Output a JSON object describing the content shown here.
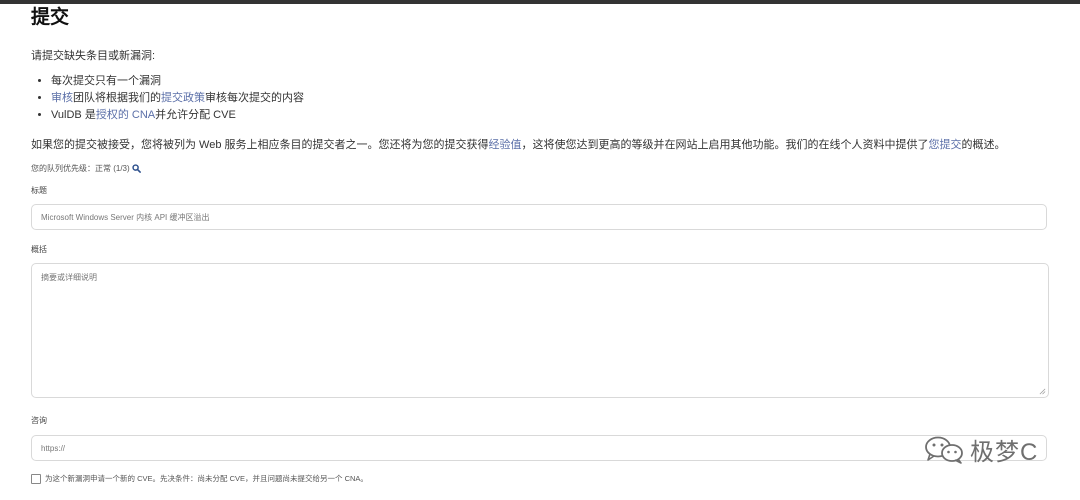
{
  "page": {
    "title": "提交",
    "intro": "请提交缺失条目或新漏洞:",
    "rules": {
      "r1": "每次提交只有一个漏洞",
      "r2_link1": "审核",
      "r2_text1": "团队将根据我们的",
      "r2_link2": "提交政策",
      "r2_text2": "审核每次提交的内容",
      "r3_text1": "VulDB 是",
      "r3_link": "授权的 CNA",
      "r3_text2": "并允许分配 CVE"
    },
    "result": {
      "text1": "如果您的提交被接受，您将被列为 Web 服务上相应条目的提交者之一。您还将为您的提交获得",
      "link1": "经验值",
      "text2": "，这将使您达到更高的等级并在网站上启用其他功能。我们的在线个人资料中提供了",
      "link2": "您提交",
      "text3": "的概述。"
    },
    "queue": "您的队列优先级：正常 (1/3)"
  },
  "form": {
    "title_label": "标题",
    "title_value": "Microsoft Windows Server 内核 API 缓冲区溢出",
    "summary_label": "概括",
    "summary_placeholder": "摘要或详细说明",
    "ref_label": "咨询",
    "ref_placeholder": "https://",
    "cve_checkbox_label": "为这个新漏洞申请一个新的 CVE。先决条件：尚未分配 CVE，并且问题尚未提交给另一个 CNA。",
    "cve_checked": false
  },
  "watermark": {
    "text": "极梦C",
    "icon": "wechat-icon"
  },
  "colors": {
    "link": "#5b6fa8",
    "text": "#333333",
    "border": "#d9d9d9"
  }
}
